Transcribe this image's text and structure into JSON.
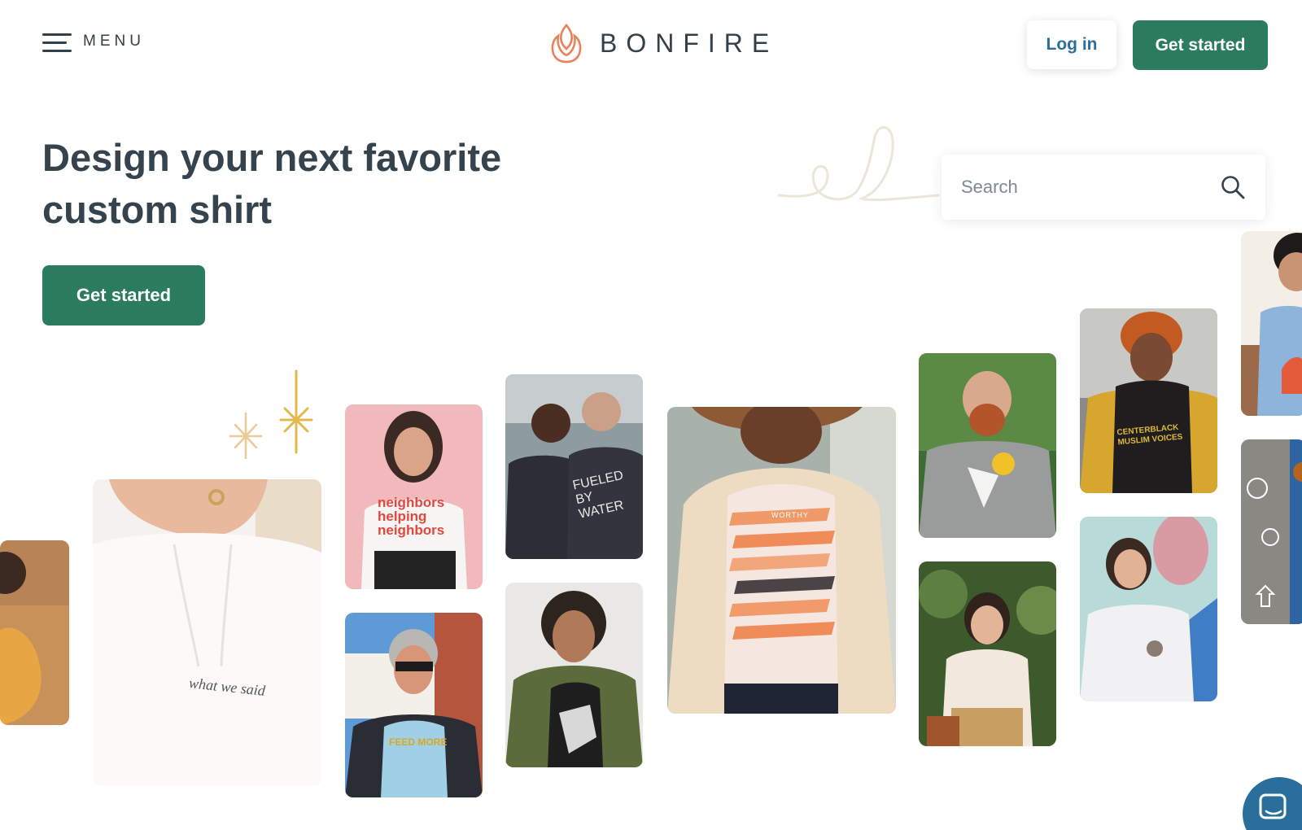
{
  "header": {
    "menu_label": "MENU",
    "brand_name": "BONFIRE",
    "login_label": "Log in",
    "cta_label": "Get started"
  },
  "hero": {
    "title": "Design your next favorite custom shirt",
    "cta_label": "Get started"
  },
  "search": {
    "placeholder": "Search"
  },
  "tiles": {
    "hoodie_text": "what we said",
    "neighbors_text": "neighbors helping neighbors",
    "water_text": "FUELED BY WATER",
    "feedmore_text": "FEED MORE",
    "worthy_text": "WORTHY",
    "voices_text": "CENTERBLACK MUSLIM VOICES"
  },
  "colors": {
    "brand_green": "#2b7c5f",
    "link_blue": "#2a6f9b",
    "logo_orange": "#e8825c",
    "text_dark": "#34434d"
  }
}
